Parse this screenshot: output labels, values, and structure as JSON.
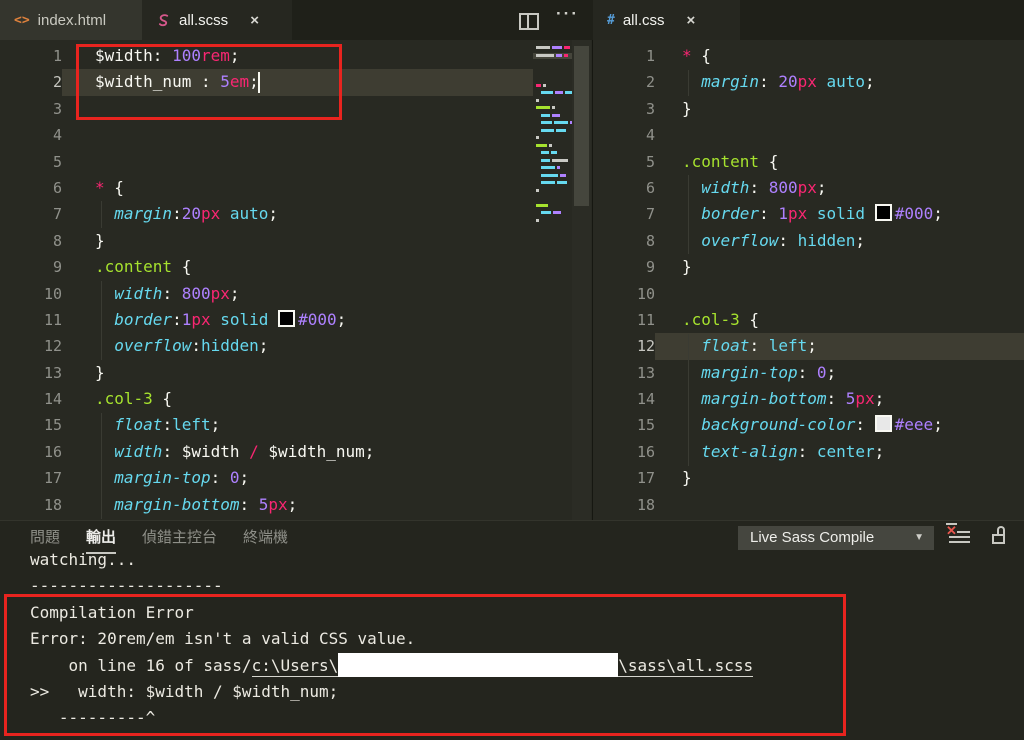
{
  "tabbar": {
    "left_tabs": [
      {
        "label": "index.html",
        "icon": "html-icon",
        "icon_glyph": "<>"
      },
      {
        "label": "all.scss",
        "icon": "sass-icon",
        "close": "×"
      }
    ],
    "actions": {
      "ellipsis": "···"
    },
    "right_tabs": [
      {
        "label": "all.css",
        "icon": "css-icon",
        "icon_glyph": "#",
        "close": "×"
      }
    ]
  },
  "editor_left": {
    "file": "all.scss",
    "lines": [
      {
        "n": "1",
        "t": [
          [
            "$width",
            "fg"
          ],
          [
            ": ",
            "fg"
          ],
          [
            "100",
            "num"
          ],
          [
            "rem",
            "unit"
          ],
          [
            ";",
            "fg"
          ]
        ]
      },
      {
        "n": "2",
        "cur": true,
        "t": [
          [
            "$width_num",
            "fg"
          ],
          [
            " : ",
            "fg"
          ],
          [
            "5",
            "num"
          ],
          [
            "em",
            "unit"
          ],
          [
            ";",
            "fg"
          ]
        ]
      },
      {
        "n": "3",
        "t": []
      },
      {
        "n": "4",
        "t": []
      },
      {
        "n": "5",
        "t": []
      },
      {
        "n": "6",
        "t": [
          [
            "*",
            "star"
          ],
          [
            " {",
            "fg"
          ]
        ]
      },
      {
        "n": "7",
        "t": [
          [
            "  ",
            "fg"
          ],
          [
            "margin",
            "prop"
          ],
          [
            ":",
            "fg"
          ],
          [
            "20",
            "num"
          ],
          [
            "px",
            "unit"
          ],
          [
            " ",
            "fg"
          ],
          [
            "auto",
            "val"
          ],
          [
            ";",
            "fg"
          ]
        ]
      },
      {
        "n": "8",
        "t": [
          [
            "}",
            "fg"
          ]
        ]
      },
      {
        "n": "9",
        "t": [
          [
            ".content",
            "sel"
          ],
          [
            " {",
            "fg"
          ]
        ]
      },
      {
        "n": "10",
        "t": [
          [
            "  ",
            "fg"
          ],
          [
            "width",
            "prop"
          ],
          [
            ": ",
            "fg"
          ],
          [
            "800",
            "num"
          ],
          [
            "px",
            "unit"
          ],
          [
            ";",
            "fg"
          ]
        ]
      },
      {
        "n": "11",
        "t": [
          [
            "  ",
            "fg"
          ],
          [
            "border",
            "prop"
          ],
          [
            ":",
            "fg"
          ],
          [
            "1",
            "num"
          ],
          [
            "px",
            "unit"
          ],
          [
            " ",
            "fg"
          ],
          [
            "solid",
            "val"
          ],
          [
            " ",
            "fg"
          ],
          [
            "",
            "swD"
          ],
          [
            "#000",
            "num"
          ],
          [
            ";",
            "fg"
          ]
        ]
      },
      {
        "n": "12",
        "t": [
          [
            "  ",
            "fg"
          ],
          [
            "overflow",
            "prop"
          ],
          [
            ":",
            "fg"
          ],
          [
            "hidden",
            "val"
          ],
          [
            ";",
            "fg"
          ]
        ]
      },
      {
        "n": "13",
        "t": [
          [
            "}",
            "fg"
          ]
        ]
      },
      {
        "n": "14",
        "t": [
          [
            ".col-3",
            "sel"
          ],
          [
            " {",
            "fg"
          ]
        ]
      },
      {
        "n": "15",
        "t": [
          [
            "  ",
            "fg"
          ],
          [
            "float",
            "prop"
          ],
          [
            ":",
            "fg"
          ],
          [
            "left",
            "val"
          ],
          [
            ";",
            "fg"
          ]
        ]
      },
      {
        "n": "16",
        "t": [
          [
            "  ",
            "fg"
          ],
          [
            "width",
            "prop"
          ],
          [
            ": ",
            "fg"
          ],
          [
            "$width",
            "fg"
          ],
          [
            " ",
            "fg"
          ],
          [
            "/",
            "op"
          ],
          [
            " ",
            "fg"
          ],
          [
            "$width_num",
            "fg"
          ],
          [
            ";",
            "fg"
          ]
        ]
      },
      {
        "n": "17",
        "t": [
          [
            "  ",
            "fg"
          ],
          [
            "margin-top",
            "prop"
          ],
          [
            ": ",
            "fg"
          ],
          [
            "0",
            "num"
          ],
          [
            ";",
            "fg"
          ]
        ]
      },
      {
        "n": "18",
        "t": [
          [
            "  ",
            "fg"
          ],
          [
            "margin-bottom",
            "prop"
          ],
          [
            ": ",
            "fg"
          ],
          [
            "5",
            "num"
          ],
          [
            "px",
            "unit"
          ],
          [
            ";",
            "fg"
          ]
        ]
      }
    ]
  },
  "editor_right": {
    "file": "all.css",
    "lines": [
      {
        "n": "1",
        "t": [
          [
            "*",
            "star"
          ],
          [
            " {",
            "fg"
          ]
        ]
      },
      {
        "n": "2",
        "t": [
          [
            "  ",
            "fg"
          ],
          [
            "margin",
            "prop"
          ],
          [
            ": ",
            "fg"
          ],
          [
            "20",
            "num"
          ],
          [
            "px",
            "unit"
          ],
          [
            " ",
            "fg"
          ],
          [
            "auto",
            "val"
          ],
          [
            ";",
            "fg"
          ]
        ]
      },
      {
        "n": "3",
        "t": [
          [
            "}",
            "fg"
          ]
        ]
      },
      {
        "n": "4",
        "t": []
      },
      {
        "n": "5",
        "t": [
          [
            ".content",
            "sel"
          ],
          [
            " {",
            "fg"
          ]
        ]
      },
      {
        "n": "6",
        "t": [
          [
            "  ",
            "fg"
          ],
          [
            "width",
            "prop"
          ],
          [
            ": ",
            "fg"
          ],
          [
            "800",
            "num"
          ],
          [
            "px",
            "unit"
          ],
          [
            ";",
            "fg"
          ]
        ]
      },
      {
        "n": "7",
        "t": [
          [
            "  ",
            "fg"
          ],
          [
            "border",
            "prop"
          ],
          [
            ": ",
            "fg"
          ],
          [
            "1",
            "num"
          ],
          [
            "px",
            "unit"
          ],
          [
            " ",
            "fg"
          ],
          [
            "solid",
            "val"
          ],
          [
            " ",
            "fg"
          ],
          [
            "",
            "swD"
          ],
          [
            "#000",
            "num"
          ],
          [
            ";",
            "fg"
          ]
        ]
      },
      {
        "n": "8",
        "t": [
          [
            "  ",
            "fg"
          ],
          [
            "overflow",
            "prop"
          ],
          [
            ": ",
            "fg"
          ],
          [
            "hidden",
            "val"
          ],
          [
            ";",
            "fg"
          ]
        ]
      },
      {
        "n": "9",
        "t": [
          [
            "}",
            "fg"
          ]
        ]
      },
      {
        "n": "10",
        "t": []
      },
      {
        "n": "11",
        "t": [
          [
            ".col-3",
            "sel"
          ],
          [
            " {",
            "fg"
          ]
        ]
      },
      {
        "n": "12",
        "cur": true,
        "t": [
          [
            "  ",
            "fg"
          ],
          [
            "float",
            "prop"
          ],
          [
            ": ",
            "fg"
          ],
          [
            "left",
            "val"
          ],
          [
            ";",
            "fg"
          ]
        ]
      },
      {
        "n": "13",
        "t": [
          [
            "  ",
            "fg"
          ],
          [
            "margin-top",
            "prop"
          ],
          [
            ": ",
            "fg"
          ],
          [
            "0",
            "num"
          ],
          [
            ";",
            "fg"
          ]
        ]
      },
      {
        "n": "14",
        "t": [
          [
            "  ",
            "fg"
          ],
          [
            "margin-bottom",
            "prop"
          ],
          [
            ": ",
            "fg"
          ],
          [
            "5",
            "num"
          ],
          [
            "px",
            "unit"
          ],
          [
            ";",
            "fg"
          ]
        ]
      },
      {
        "n": "15",
        "t": [
          [
            "  ",
            "fg"
          ],
          [
            "background-color",
            "prop"
          ],
          [
            ": ",
            "fg"
          ],
          [
            "",
            "swL"
          ],
          [
            "#eee",
            "num"
          ],
          [
            ";",
            "fg"
          ]
        ]
      },
      {
        "n": "16",
        "t": [
          [
            "  ",
            "fg"
          ],
          [
            "text-align",
            "prop"
          ],
          [
            ": ",
            "fg"
          ],
          [
            "center",
            "val"
          ],
          [
            ";",
            "fg"
          ]
        ]
      },
      {
        "n": "17",
        "t": [
          [
            "}",
            "fg"
          ]
        ]
      },
      {
        "n": "18",
        "t": []
      }
    ]
  },
  "panel": {
    "tabs": [
      {
        "label": "問題"
      },
      {
        "label": "輸出",
        "active": true
      },
      {
        "label": "偵錯主控台"
      },
      {
        "label": "終端機"
      }
    ],
    "dropdown": {
      "value": "Live Sass Compile",
      "caret": "▼"
    },
    "output": {
      "lines": [
        "watching...",
        "--------------------",
        "Compilation Error",
        "Error: 20rem/em isn't a valid CSS value.",
        {
          "type": "path",
          "prefix": "    on line 16 of sass/",
          "link_head": "c:\\Users\\",
          "redacted": true,
          "link_tail": "\\sass\\all.scss"
        },
        ">>   width: $width / $width_num;",
        "   ---------^"
      ]
    }
  },
  "colors": {
    "accent_red_annotation": "#e8241f",
    "editor_bg": "#282922",
    "cyan": "#66d9ef",
    "green": "#a6e22e",
    "pink": "#f92672",
    "purple": "#ae81ff",
    "sass_pink": "#d6588c"
  }
}
